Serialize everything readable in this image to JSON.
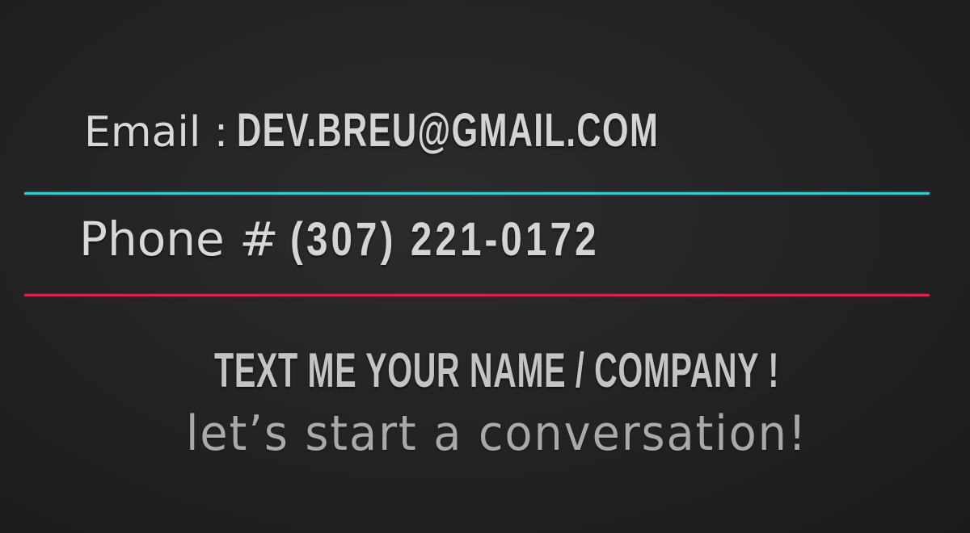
{
  "contact": {
    "email_label": "Email :",
    "email_value": "DEV.BREU@GMAIL.COM",
    "phone_label": "Phone #",
    "phone_value": "(307) 221-0172"
  },
  "call_to_action": {
    "headline": "TEXT ME YOUR NAME / COMPANY !",
    "tagline": "let’s start a conversation!"
  },
  "colors": {
    "background": "#222223",
    "divider_email": "#3fc3d6",
    "divider_phone": "#e0224a",
    "text_primary": "#d6d6d6",
    "text_secondary": "#a9a9a9"
  }
}
